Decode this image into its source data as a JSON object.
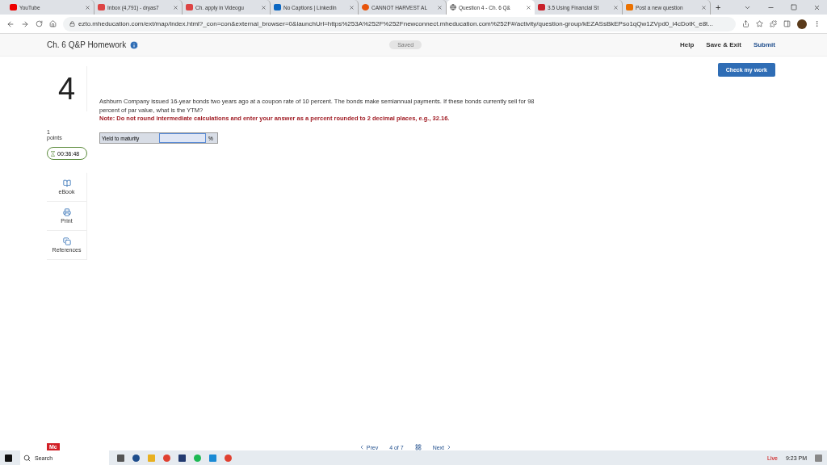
{
  "browser": {
    "tabs": [
      {
        "title": "YouTube",
        "selected": false
      },
      {
        "title": "Inbox (4,791) - dryas7",
        "selected": false
      },
      {
        "title": "Ch. apply in Videogu",
        "selected": false
      },
      {
        "title": "No Captions | LinkedIn",
        "selected": false
      },
      {
        "title": "CANNOT HARVEST AL",
        "selected": false
      },
      {
        "title": "Question 4 - Ch. 6 Q&",
        "selected": true
      },
      {
        "title": "3.5 Using Financial St",
        "selected": false
      },
      {
        "title": "Post a new question",
        "selected": false
      }
    ],
    "new_tab": "+",
    "address": "ezto.mheducation.com/ext/map/index.html?_con=con&external_browser=0&launchUrl=https%253A%252F%252Fnewconnect.mheducation.com%252F#/activity/question-group/kEZASsBkEPso1qQw1ZVpd0_i4cDotK_e8t..."
  },
  "header": {
    "title": "Ch. 6 Q&P Homework",
    "status": "Saved",
    "links": [
      "Help",
      "Save & Exit",
      "Submit"
    ]
  },
  "check_button": "Check my work",
  "question": {
    "number": "4",
    "points_value": "1",
    "points_label": "points",
    "timer": "00:36:48",
    "text": "Ashburn Company issued 16-year bonds two years ago at a coupon rate of 10 percent. The bonds make semiannual payments. If these bonds currently sell for 98 percent of par value, what is the YTM?",
    "note": "Note: Do not round intermediate calculations and enter your answer as a percent rounded to 2 decimal places, e.g., 32.16.",
    "answer": {
      "label": "Yield to maturity",
      "unit": "%"
    }
  },
  "tools": [
    {
      "label": "eBook",
      "kind": "book"
    },
    {
      "label": "Print",
      "kind": "print"
    },
    {
      "label": "References",
      "kind": "refs"
    }
  ],
  "footer": {
    "logo": "Mc",
    "prev": "Prev",
    "page": "4 of 7",
    "next": "Next"
  },
  "taskbar": {
    "search": "Search",
    "live": "Live",
    "time": "9:23 PM"
  }
}
